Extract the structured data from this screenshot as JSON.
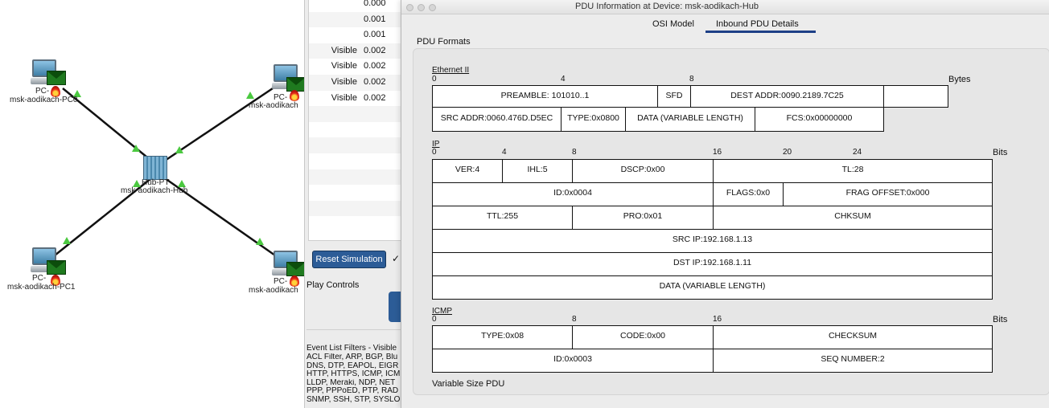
{
  "topology": {
    "nodes": {
      "pc0": {
        "type": "PC-",
        "name": "msk-aodikach-PC0"
      },
      "pc1": {
        "type": "PC-",
        "name": "msk-aodikach-PC1"
      },
      "pc2": {
        "type": "PC-",
        "name": "msk-aodikach"
      },
      "pc3": {
        "type": "PC-",
        "name": "msk-aodikach"
      },
      "hub": {
        "type": "Hub-PT",
        "name": "msk-aodikach-Hub"
      }
    },
    "link_color": "#111111",
    "link_status_color": "#4bc940"
  },
  "simulation": {
    "events": [
      {
        "visible": "",
        "time": "0.000"
      },
      {
        "visible": "",
        "time": "0.001"
      },
      {
        "visible": "",
        "time": "0.001"
      },
      {
        "visible": "Visible",
        "time": "0.002"
      },
      {
        "visible": "Visible",
        "time": "0.002"
      },
      {
        "visible": "Visible",
        "time": "0.002"
      },
      {
        "visible": "Visible",
        "time": "0.002"
      }
    ],
    "reset_label": "Reset Simulation",
    "checkmark": "✓",
    "play_controls_label": "Play Controls",
    "filters_title": "Event List Filters - Visible",
    "filter_lines": [
      "ACL Filter, ARP, BGP, Blu",
      "DNS, DTP, EAPOL, EIGR",
      "HTTP, HTTPS, ICMP, ICM",
      "LLDP, Meraki, NDP, NET",
      "PPP, PPPoED, PTP, RAD",
      "SNMP, SSH, STP, SYSLO"
    ],
    "accent_color": "#2c5c97"
  },
  "pdu_window": {
    "title": "PDU Information at Device: msk-aodikach-Hub",
    "tabs": [
      "OSI Model",
      "Inbound PDU Details"
    ],
    "active_tab": "Inbound PDU Details",
    "formats_label": "PDU Formats",
    "ethernet": {
      "title": "Ethernet II",
      "ticks": [
        "0",
        "4",
        "8"
      ],
      "unit": "Bytes",
      "fields": {
        "preamble": "PREAMBLE: 101010..1",
        "sfd": "SFD",
        "dest": "DEST ADDR:0090.2189.7C25",
        "extra": "",
        "src": "SRC ADDR:0060.476D.D5EC",
        "type": "TYPE:0x0800",
        "data": "DATA (VARIABLE LENGTH)",
        "fcs": "FCS:0x00000000"
      }
    },
    "ip": {
      "title": "IP",
      "ticks": [
        "0",
        "4",
        "8",
        "16",
        "20",
        "24"
      ],
      "unit": "Bits",
      "fields": {
        "ver": "VER:4",
        "ihl": "IHL:5",
        "dscp": "DSCP:0x00",
        "tl": "TL:28",
        "id": "ID:0x0004",
        "flags": "FLAGS:0x0",
        "frag": "FRAG OFFSET:0x000",
        "ttl": "TTL:255",
        "pro": "PRO:0x01",
        "chksum": "CHKSUM",
        "src": "SRC IP:192.168.1.13",
        "dst": "DST IP:192.168.1.11",
        "data": "DATA (VARIABLE LENGTH)"
      }
    },
    "icmp": {
      "title": "ICMP",
      "ticks": [
        "0",
        "8",
        "16"
      ],
      "unit": "Bits",
      "fields": {
        "type": "TYPE:0x08",
        "code": "CODE:0x00",
        "checksum": "CHECKSUM",
        "id": "ID:0x0003",
        "seq": "SEQ NUMBER:2"
      }
    },
    "variable_size_label": "Variable Size PDU",
    "accent_color": "#1d3f86"
  }
}
